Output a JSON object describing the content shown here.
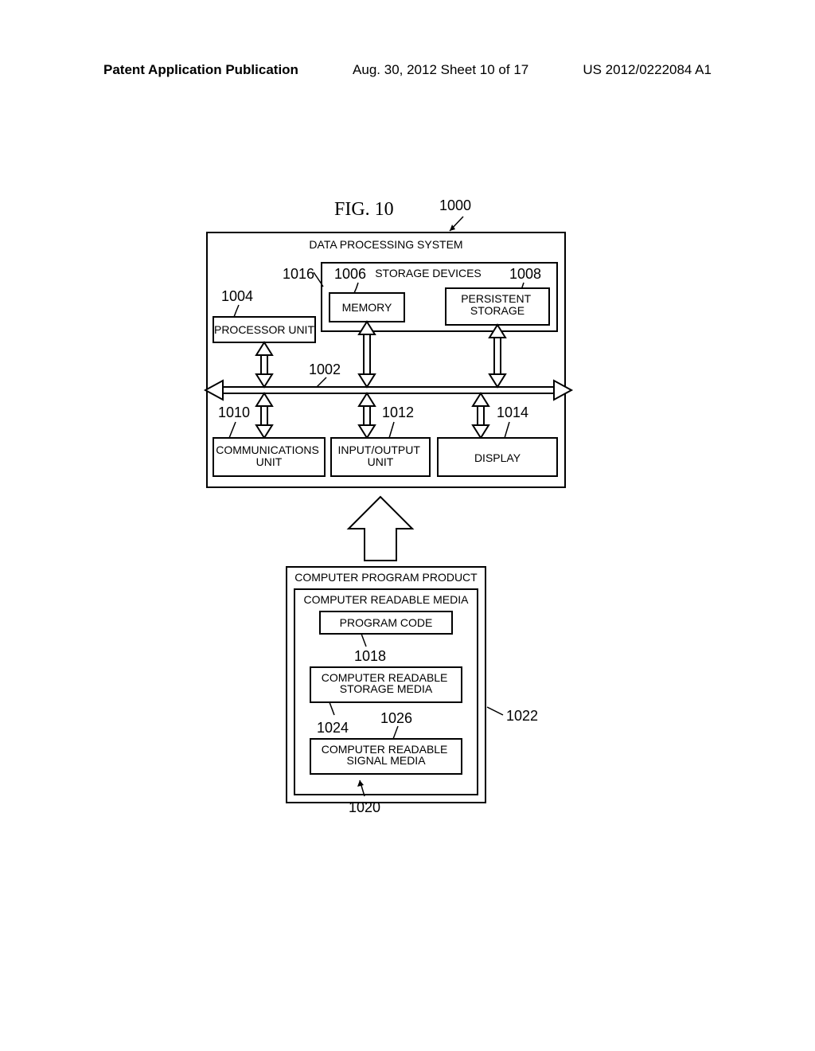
{
  "header": {
    "left": "Patent Application Publication",
    "mid": "Aug. 30, 2012  Sheet 10 of 17",
    "right": "US 2012/0222084 A1"
  },
  "figure": {
    "label": "FIG. 10",
    "main_ref": "1000",
    "dps_title": "DATA PROCESSING SYSTEM",
    "storage_devices": "STORAGE DEVICES",
    "processor": "PROCESSOR UNIT",
    "memory": "MEMORY",
    "persistent": "PERSISTENT STORAGE",
    "comm": "COMMUNICATIONS UNIT",
    "io": "INPUT/OUTPUT UNIT",
    "display": "DISPLAY",
    "cpp_title": "COMPUTER PROGRAM PRODUCT",
    "crm_title": "COMPUTER READABLE MEDIA",
    "program_code": "PROGRAM CODE",
    "cr_storage": "COMPUTER READABLE STORAGE MEDIA",
    "cr_signal": "COMPUTER READABLE SIGNAL MEDIA",
    "refs": {
      "r1002": "1002",
      "r1004": "1004",
      "r1006": "1006",
      "r1008": "1008",
      "r1010": "1010",
      "r1012": "1012",
      "r1014": "1014",
      "r1016": "1016",
      "r1018": "1018",
      "r1020": "1020",
      "r1022": "1022",
      "r1024": "1024",
      "r1026": "1026"
    }
  }
}
